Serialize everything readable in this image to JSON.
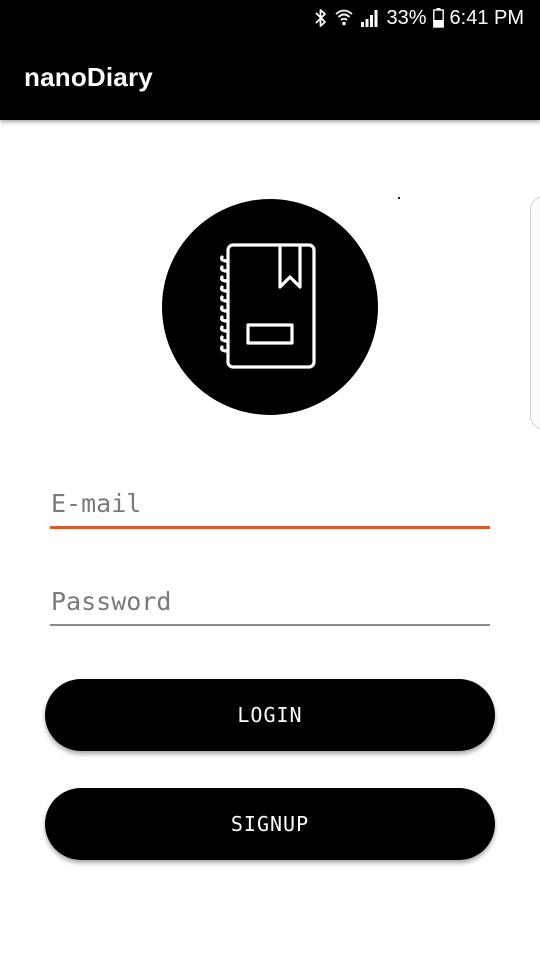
{
  "status_bar": {
    "battery_percent": "33%",
    "time": "6:41 PM",
    "icons": [
      "bluetooth-icon",
      "wifi-icon",
      "signal-icon",
      "battery-icon"
    ]
  },
  "app_bar": {
    "title": "nanoDiary"
  },
  "logo": {
    "icon": "notebook-icon"
  },
  "form": {
    "email_placeholder": "E-mail",
    "email_value": "",
    "password_placeholder": "Password",
    "password_value": ""
  },
  "buttons": {
    "login_label": "LOGIN",
    "signup_label": "SIGNUP"
  },
  "colors": {
    "primary": "#000000",
    "accent": "#e0582a",
    "background": "#ffffff"
  }
}
